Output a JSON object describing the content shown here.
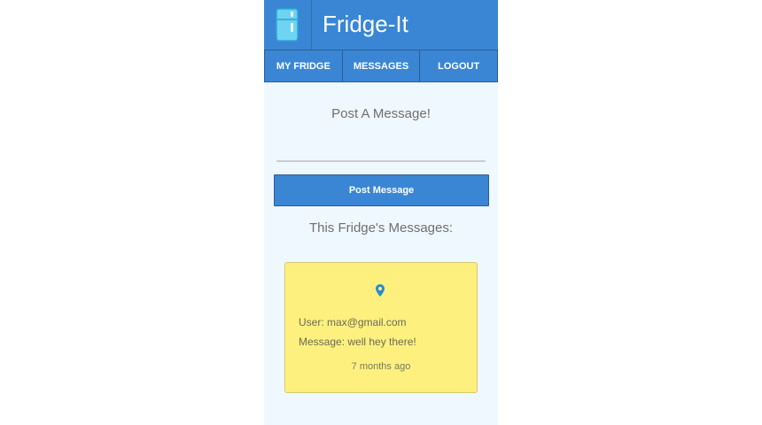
{
  "app": {
    "title": "Fridge-It",
    "logo_icon": "fridge-icon",
    "accent": "#3a86d4"
  },
  "nav": {
    "items": [
      {
        "label": "MY FRIDGE"
      },
      {
        "label": "MESSAGES"
      },
      {
        "label": "LOGOUT"
      }
    ]
  },
  "post": {
    "heading": "Post A Message!",
    "input_value": "",
    "input_placeholder": "",
    "button_label": "Post Message"
  },
  "messages": {
    "heading": "This Fridge's Messages:",
    "items": [
      {
        "icon": "location-pin-icon",
        "user_line": "User: max@gmail.com",
        "message_line": "Message: well hey there!",
        "time": "7 months ago",
        "card_color": "#fdf07f"
      }
    ]
  }
}
